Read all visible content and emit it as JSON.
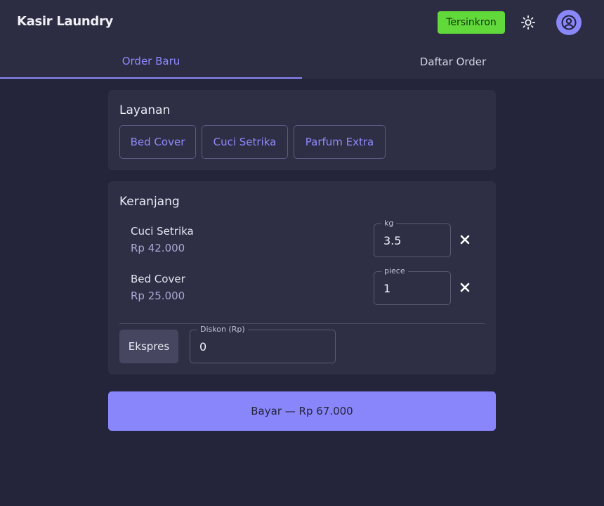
{
  "header": {
    "title": "Kasir Laundry",
    "sync_status": "Tersinkron",
    "theme_icon": "sun-icon",
    "avatar_icon": "user-circle-icon"
  },
  "tabs": [
    {
      "label": "Order Baru",
      "active": true
    },
    {
      "label": "Daftar Order",
      "active": false
    }
  ],
  "services": {
    "title": "Layanan",
    "items": [
      "Bed Cover",
      "Cuci Setrika",
      "Parfum Extra"
    ]
  },
  "cart": {
    "title": "Keranjang",
    "items": [
      {
        "name": "Cuci Setrika",
        "price": "Rp 42.000",
        "unit": "kg",
        "qty": "3.5"
      },
      {
        "name": "Bed Cover",
        "price": "Rp 25.000",
        "unit": "piece",
        "qty": "1"
      }
    ],
    "express_label": "Ekspres",
    "discount": {
      "label": "Diskon (Rp)",
      "value": "0"
    }
  },
  "pay_button": "Bayar — Rp 67.000",
  "colors": {
    "accent": "#8986fc",
    "background": "#24243a",
    "card": "#2e2e45",
    "sync_green": "#62d93a"
  }
}
